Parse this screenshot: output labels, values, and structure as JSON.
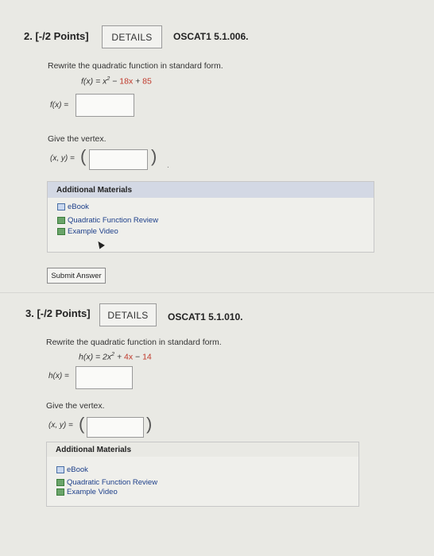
{
  "questions": [
    {
      "header": "2. [-/2 Points]",
      "details_label": "DETAILS",
      "code": "OSCAT1 5.1.006.",
      "prompt": "Rewrite the quadratic function in standard form.",
      "func_lhs": "f(x) = x",
      "func_exp": "2",
      "func_minus": " − ",
      "func_b": "18x",
      "func_plus": " + ",
      "func_c": "85",
      "answer_label": "f(x) =",
      "answer_value": "",
      "vertex_prompt": "Give the vertex.",
      "vertex_label": "(x, y) =",
      "vertex_value": "",
      "additional_materials": {
        "title": "Additional Materials",
        "items": [
          "eBook",
          "Quadratic Function Review",
          "Example Video"
        ]
      },
      "submit_label": "Submit Answer"
    },
    {
      "header": "3. [-/2 Points]",
      "details_label": "DETAILS",
      "code": "OSCAT1 5.1.010.",
      "prompt": "Rewrite the quadratic function in standard form.",
      "func_lhs": "h(x) = 2x",
      "func_exp": "2",
      "func_plus1": " + ",
      "func_b": "4x",
      "func_minus": " − ",
      "func_c": "14",
      "answer_label": "h(x) =",
      "answer_value": "",
      "vertex_prompt": "Give the vertex.",
      "vertex_label": "(x, y) =",
      "vertex_value": "",
      "additional_materials": {
        "title": "Additional Materials",
        "items": [
          "eBook",
          "Quadratic Function Review",
          "Example Video"
        ]
      }
    }
  ],
  "colors": {
    "coefficient_red": "#c0392b",
    "link_blue": "#1d3f8a",
    "materials_header": "#d3d8e4"
  }
}
